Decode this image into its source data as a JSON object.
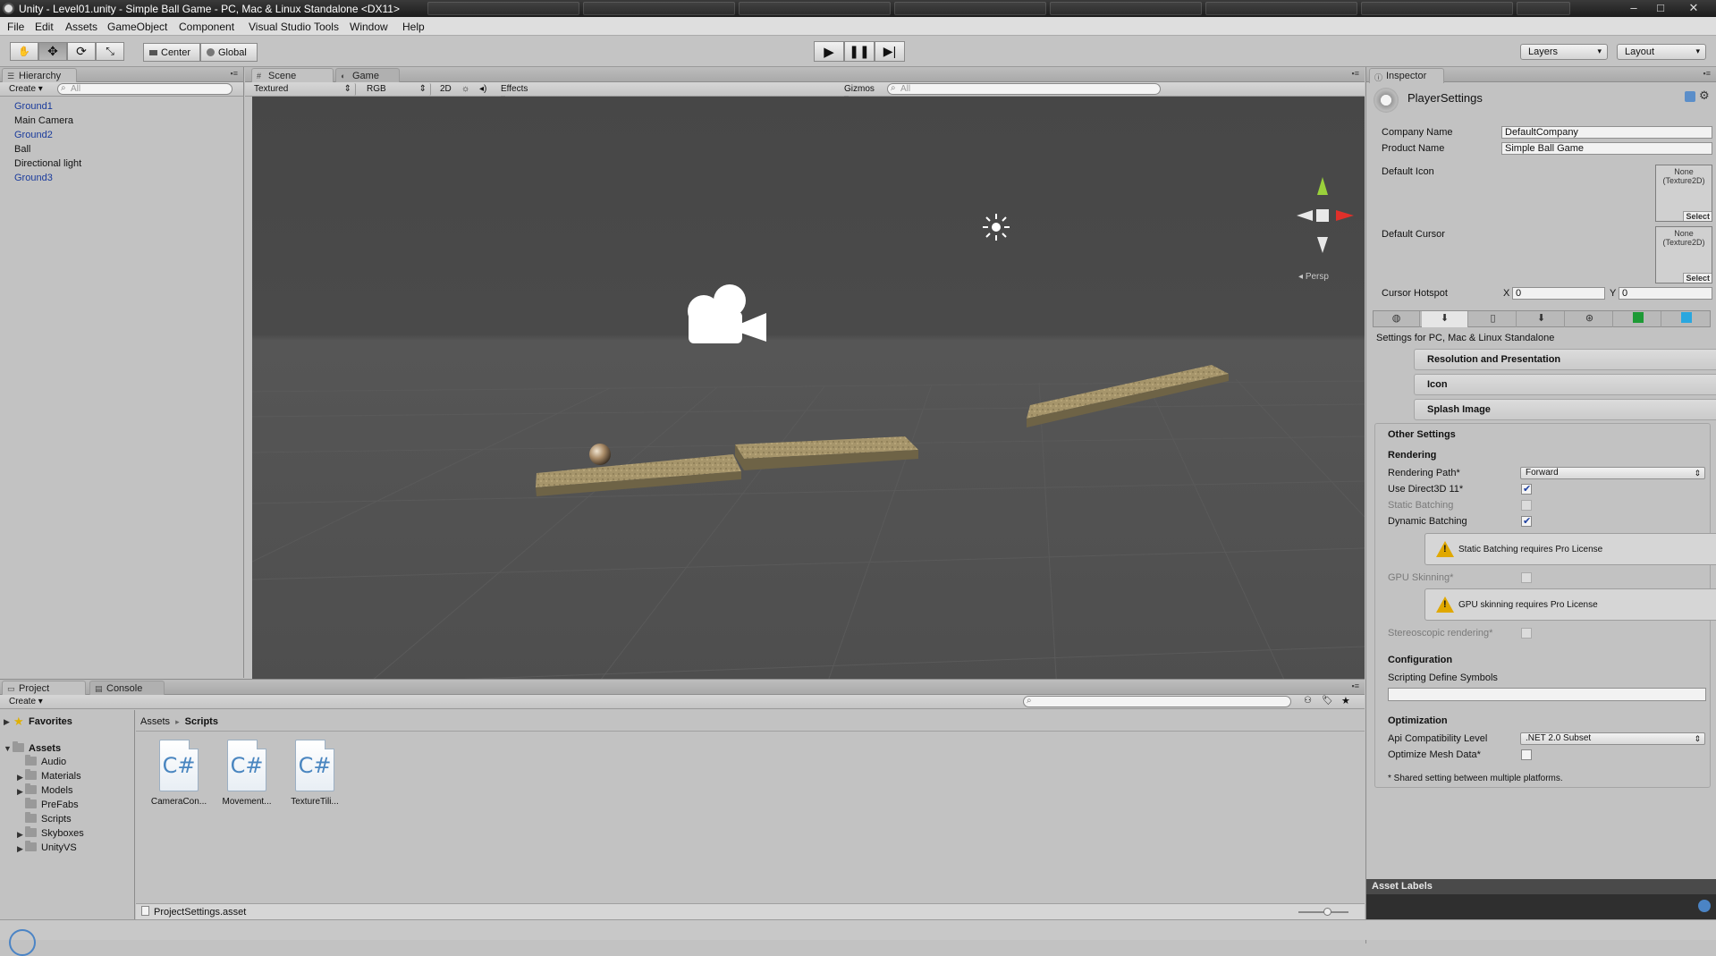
{
  "window": {
    "title": "Unity - Level01.unity - Simple Ball Game - PC, Mac & Linux Standalone <DX11>",
    "controls": [
      "–",
      "□",
      "✕"
    ]
  },
  "menu": [
    "File",
    "Edit",
    "Assets",
    "GameObject",
    "Component",
    "Visual Studio Tools",
    "Window",
    "Help"
  ],
  "toolbar": {
    "pivot_label": "Center",
    "space_label": "Global",
    "layers_label": "Layers",
    "layout_label": "Layout"
  },
  "hierarchy": {
    "tab_label": "Hierarchy",
    "create_label": "Create",
    "search_placeholder": "All",
    "items": [
      {
        "label": "Ground1",
        "prefab": true
      },
      {
        "label": "Main Camera",
        "prefab": false
      },
      {
        "label": "Ground2",
        "prefab": true
      },
      {
        "label": "Ball",
        "prefab": false
      },
      {
        "label": "Directional light",
        "prefab": false
      },
      {
        "label": "Ground3",
        "prefab": true
      }
    ]
  },
  "scene": {
    "tabs": [
      "Scene",
      "Game"
    ],
    "draw_mode": "Textured",
    "render_mode": "RGB",
    "mode_2d": "2D",
    "effects_label": "Effects",
    "gizmos_label": "Gizmos",
    "search_placeholder": "All",
    "persp_label": "Persp"
  },
  "inspector": {
    "tab_label": "Inspector",
    "object_name": "PlayerSettings",
    "company_label": "Company Name",
    "company_value": "DefaultCompany",
    "product_label": "Product Name",
    "product_value": "Simple Ball Game",
    "default_icon_label": "Default Icon",
    "default_cursor_label": "Default Cursor",
    "texture_none": "None\n(Texture2D)",
    "select_label": "Select",
    "hotspot_label": "Cursor Hotspot",
    "hotspot_x_label": "X",
    "hotspot_x": "0",
    "hotspot_y_label": "Y",
    "hotspot_y": "0",
    "platform_settings_label": "Settings for PC, Mac & Linux Standalone",
    "sections": [
      "Resolution and Presentation",
      "Icon",
      "Splash Image"
    ],
    "other_settings": {
      "header": "Other Settings",
      "rendering_header": "Rendering",
      "rendering_path_label": "Rendering Path*",
      "rendering_path_value": "Forward",
      "direct3d_label": "Use Direct3D 11*",
      "static_batching_label": "Static Batching",
      "dynamic_batching_label": "Dynamic Batching",
      "warn_static": "Static Batching requires Pro License",
      "gpu_skinning_label": "GPU Skinning*",
      "warn_gpu": "GPU skinning requires Pro License",
      "stereo_label": "Stereoscopic rendering*",
      "configuration_header": "Configuration",
      "define_symbols_label": "Scripting Define Symbols",
      "define_symbols_value": "",
      "optimization_header": "Optimization",
      "api_level_label": "Api Compatibility Level",
      "api_level_value": ".NET 2.0 Subset",
      "optimize_mesh_label": "Optimize Mesh Data*",
      "shared_note": "* Shared setting between multiple platforms."
    },
    "asset_labels": "Asset Labels"
  },
  "project": {
    "tabs": [
      "Project",
      "Console"
    ],
    "create_label": "Create",
    "favorites_label": "Favorites",
    "assets_label": "Assets",
    "folders": [
      "Audio",
      "Materials",
      "Models",
      "PreFabs",
      "Scripts",
      "Skyboxes",
      "UnityVS"
    ],
    "breadcrumb": [
      "Assets",
      "Scripts"
    ],
    "files": [
      "CameraCon...",
      "Movement...",
      "TextureTili..."
    ],
    "file_icon_label": "C#",
    "selected_file": "ProjectSettings.asset"
  }
}
